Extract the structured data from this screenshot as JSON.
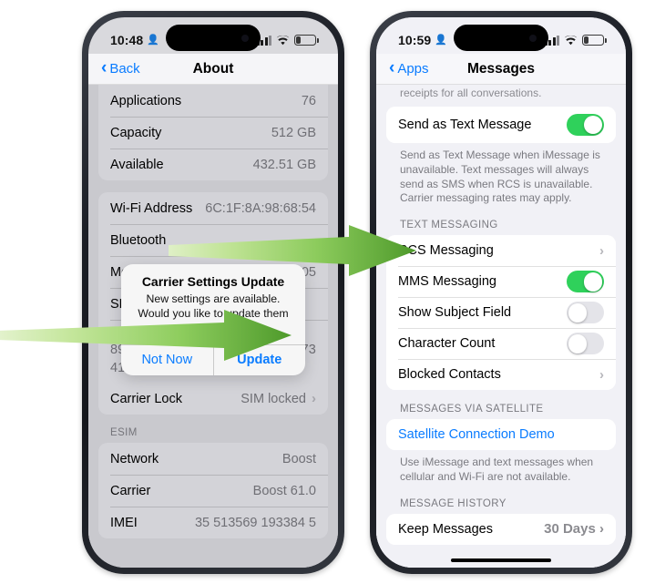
{
  "colors": {
    "accent_blue": "#0a7cff",
    "toggle_green": "#2fd15b",
    "arrow_green_light": "#b4e08a",
    "arrow_green_dark": "#4e9a2b",
    "frame_dark": "#1c1f26"
  },
  "left_phone": {
    "status": {
      "time": "10:48",
      "person_icon": "person-icon",
      "signal_icon": "cellular-bars-icon",
      "wifi_icon": "wifi-icon",
      "battery_icon": "battery-low-icon"
    },
    "nav": {
      "back_label": "Back",
      "title": "About"
    },
    "group1": [
      {
        "label": "Applications",
        "value": "76"
      },
      {
        "label": "Capacity",
        "value": "512 GB"
      },
      {
        "label": "Available",
        "value": "432.51 GB"
      }
    ],
    "group2": [
      {
        "label": "Wi-Fi Address",
        "value": "6C:1F:8A:98:68:54"
      },
      {
        "label": "Bluetooth",
        "value": ""
      },
      {
        "label": "Mo",
        "value": "05"
      },
      {
        "label": "SE",
        "value": ""
      }
    ],
    "iccid": {
      "label": "",
      "value": "89049032007408885100201321734167"
    },
    "carrier_lock": {
      "label": "Carrier Lock",
      "value": "SIM locked"
    },
    "esim_header": "ESIM",
    "esim_rows": [
      {
        "label": "Network",
        "value": "Boost"
      },
      {
        "label": "Carrier",
        "value": "Boost 61.0"
      },
      {
        "label": "IMEI",
        "value": "35 513569 193384 5"
      }
    ],
    "alert": {
      "title": "Carrier Settings Update",
      "message": "New settings are available. Would you like to update them now?",
      "cancel_label": "Not Now",
      "update_label": "Update"
    }
  },
  "right_phone": {
    "status": {
      "time": "10:59",
      "person_icon": "person-icon",
      "signal_icon": "cellular-bars-icon",
      "wifi_icon": "wifi-icon",
      "battery_icon": "battery-low-icon"
    },
    "nav": {
      "back_label": "Apps",
      "title": "Messages"
    },
    "partial_note": "receipts for all conversations.",
    "send_as_text": {
      "label": "Send as Text Message",
      "toggle": "on"
    },
    "send_as_text_footnote": "Send as Text Message when iMessage is unavailable. Text messages will always send as SMS when RCS is unavailable. Carrier messaging rates may apply.",
    "text_messaging_header": "TEXT MESSAGING",
    "text_messaging_rows": [
      {
        "label": "RCS Messaging",
        "type": "disclosure"
      },
      {
        "label": "MMS Messaging",
        "type": "toggle",
        "toggle": "on"
      },
      {
        "label": "Show Subject Field",
        "type": "toggle",
        "toggle": "off"
      },
      {
        "label": "Character Count",
        "type": "toggle",
        "toggle": "off"
      },
      {
        "label": "Blocked Contacts",
        "type": "disclosure"
      }
    ],
    "satellite_header": "MESSAGES VIA SATELLITE",
    "satellite_link": "Satellite Connection Demo",
    "satellite_footnote": "Use iMessage and text messages when cellular and Wi-Fi are not available.",
    "history_header": "MESSAGE HISTORY",
    "keep_messages": {
      "label": "Keep Messages",
      "value": "30 Days"
    }
  },
  "annotations": {
    "arrow_top_name": "green-arrow-pointing-to-rcs-messaging",
    "arrow_bottom_name": "green-arrow-pointing-to-update-button"
  }
}
